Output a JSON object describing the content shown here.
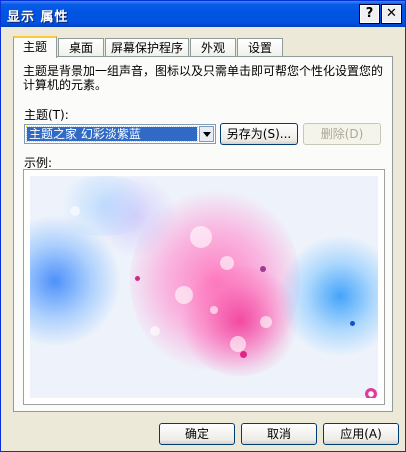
{
  "window": {
    "title": "显示 属性"
  },
  "title_buttons": {
    "help": "?",
    "close": "✕"
  },
  "tabs": [
    "主题",
    "桌面",
    "屏幕保护程序",
    "外观",
    "设置"
  ],
  "description": "主题是背景加一组声音，图标以及只需单击即可帮您个性化设置您的计算机的元素。",
  "theme": {
    "label": "主题(T):",
    "selected": "主题之家 幻彩淡紫蓝",
    "save_as_label": "另存为(S)...",
    "delete_label": "删除(D)"
  },
  "preview": {
    "label": "示例:"
  },
  "footer": {
    "ok": "确定",
    "cancel": "取消",
    "apply": "应用(A)"
  },
  "colors": {
    "title_bar": "#0054e3",
    "selection": "#316ac5",
    "tab_highlight": "#ffc83c"
  },
  "icons": {
    "help": "question-mark-icon",
    "close": "close-x-icon",
    "dropdown": "chevron-down-icon"
  }
}
